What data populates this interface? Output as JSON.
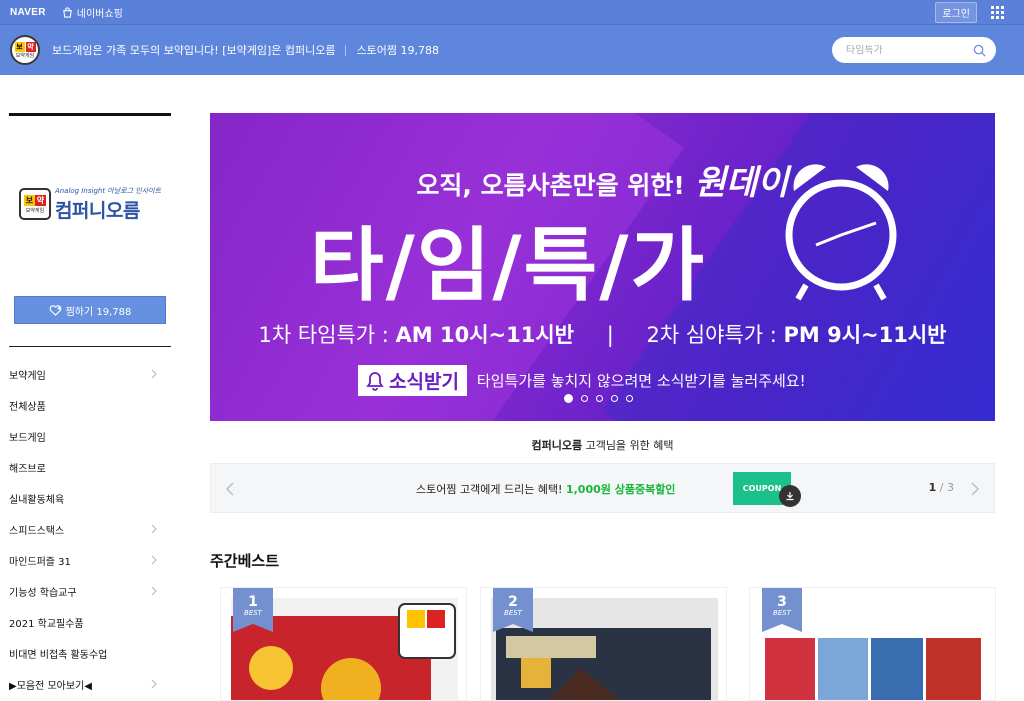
{
  "topbar": {
    "brand": "NAVER",
    "shopping": "네이버쇼핑",
    "login": "로그인"
  },
  "store": {
    "title": "보드게임은 가족 모두의 보약입니다! [보약게임]은 컴퍼니오름",
    "fav": "스토어찜 19,788",
    "search_placeholder": "타임특가",
    "logo_badge": [
      "보",
      "약"
    ],
    "logo_badge_sub": "보약게임"
  },
  "sidebar": {
    "logo_sub": "Analog Insight 아날로그 인사이트",
    "logo_main": "컴퍼니오름",
    "fav_button": "찜하기 19,788",
    "menu": [
      {
        "label": "보약게임",
        "chevron": true
      },
      {
        "label": "전체상품",
        "chevron": false
      },
      {
        "label": "보드게임",
        "chevron": false
      },
      {
        "label": "해즈브로",
        "chevron": false
      },
      {
        "label": "실내활동체육",
        "chevron": false
      },
      {
        "label": "스피드스택스",
        "chevron": true
      },
      {
        "label": "마인드퍼즐 31",
        "chevron": true
      },
      {
        "label": "기능성 학습교구",
        "chevron": true
      },
      {
        "label": "2021 학교필수품",
        "chevron": false
      },
      {
        "label": "비대면 비접촉 활동수업",
        "chevron": false
      },
      {
        "label": "▶모음전 모아보기◀",
        "chevron": true
      }
    ]
  },
  "banner": {
    "line1_small": "오직, 오름사촌만을 위한!",
    "line1_big": "원데이",
    "title": "타/임/특/가",
    "schedule_1_label": "1차 타임특가 : ",
    "schedule_1_time": "AM 10시~11시반",
    "schedule_sep": "|",
    "schedule_2_label": "2차 심야특가 : ",
    "schedule_2_time": "PM 9시~11시반",
    "notice_button": "소식받기",
    "notice_text": "타임특가를 놓치지 않으려면 소식받기를 눌러주세요!",
    "slides": 5,
    "active_slide": 1
  },
  "benefit": {
    "store_name": "컴퍼니오름",
    "title_rest": " 고객님을 위한 혜택",
    "coupon_text": "스토어찜 고객에게 드리는 혜택! ",
    "coupon_highlight": "1,000원 상품중복할인",
    "coupon_button": "COUPON",
    "page_current": "1",
    "page_total": " / 3"
  },
  "best": {
    "title": "주간베스트",
    "items": [
      {
        "rank": "1",
        "tag": "BEST"
      },
      {
        "rank": "2",
        "tag": "BEST"
      },
      {
        "rank": "3",
        "tag": "BEST"
      }
    ]
  },
  "colors": {
    "topbar": "#5b80d9",
    "storebar": "#5f86dd",
    "accent_green": "#17b53a",
    "coupon": "#1cc08a",
    "rank_badge": "#7590cf"
  }
}
